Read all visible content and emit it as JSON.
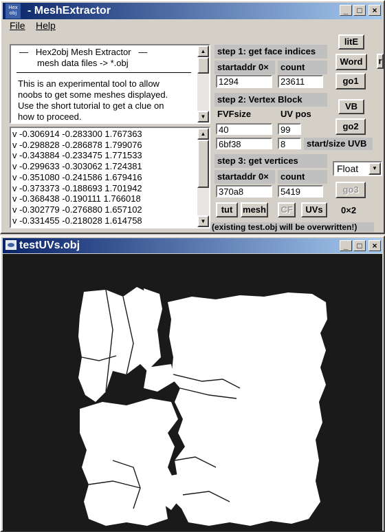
{
  "main_window": {
    "icon_text": [
      "Hex",
      "obj"
    ],
    "title": "MeshExtractor",
    "controls": {
      "minimize": "_",
      "maximize": "□",
      "close": "×"
    },
    "menu": [
      "File",
      "Help"
    ],
    "intro": {
      "line1": "—   Hex2obj Mesh Extractor   —",
      "line2": "mesh data files -> *.obj",
      "body": [
        "This is an experimental tool to allow",
        "noobs to get some meshes displayed.",
        "Use the short tutorial to get a clue on",
        "how to proceed."
      ]
    },
    "vertices": [
      "v -0.306914 -0.283300 1.767363",
      "v -0.298828 -0.286878 1.799076",
      "v -0.343884 -0.233475 1.771533",
      "v -0.299633 -0.303062 1.724381",
      "v -0.351080 -0.241586 1.679416",
      "v -0.373373 -0.188693 1.701942",
      "v -0.368438 -0.190111 1.766018",
      "v -0.302779 -0.276880 1.657102",
      "v -0.331455 -0.218028 1.614758"
    ],
    "step1": {
      "label": "step 1: get face indices",
      "addr_label": "startaddr 0×",
      "count_label": "count",
      "addr": "1294",
      "count": "23611"
    },
    "step2": {
      "label": "step 2: Vertex Block",
      "fvf_label": "FVFsize",
      "uv_label": "UV pos",
      "fvf": "40",
      "uv": "99",
      "uvb_addr": "6bf38",
      "uvb_size": "8",
      "uvb_label": "start/size UVB"
    },
    "step3": {
      "label": "step 3: get vertices",
      "addr_label": "startaddr 0×",
      "count_label": "count",
      "addr": "370a8",
      "count": "5419"
    },
    "buttons": {
      "lite": "litE",
      "word": "Word",
      "go1": "go1",
      "vb": "VB",
      "go2": "go2",
      "go3": "go3",
      "tut": "tut",
      "mesh": "mesh",
      "cf": "CF",
      "uvs": "UVs",
      "ox2": "0×2",
      "r": "r"
    },
    "format_select": "Float",
    "warning": "(existing test.obj will be overwritten!)"
  },
  "uv_window": {
    "title": "testUVs.obj",
    "controls": {
      "minimize": "_",
      "maximize": "□",
      "close": "×"
    },
    "colors": {
      "background": "#1a1a1a",
      "uv": "#ffffff"
    }
  }
}
